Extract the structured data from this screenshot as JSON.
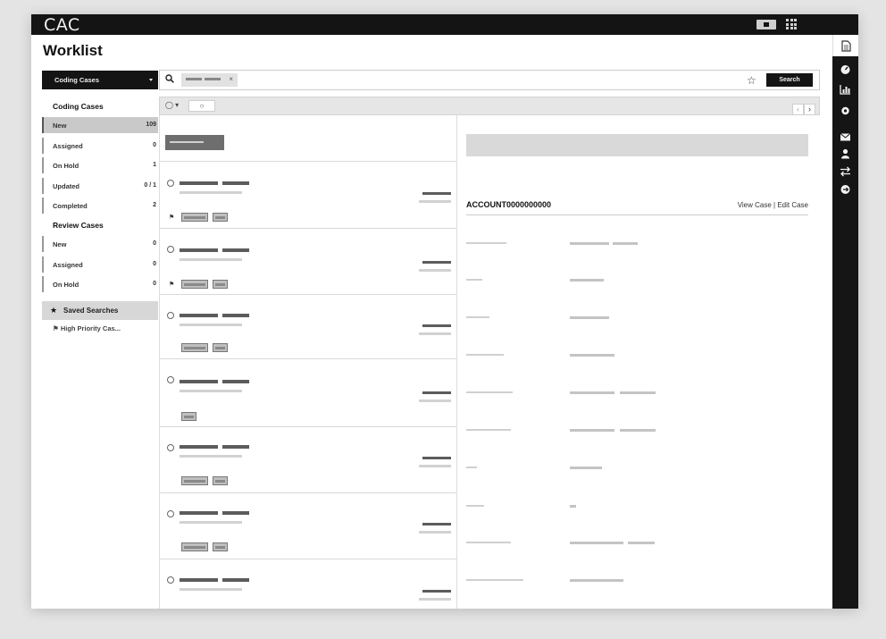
{
  "app": {
    "title": "CAC"
  },
  "page": {
    "title": "Worklist"
  },
  "sidebar": {
    "dropdown_label": "Coding Cases",
    "coding_heading": "Coding Cases",
    "coding_items": [
      {
        "label": "New",
        "count": "109"
      },
      {
        "label": "Assigned",
        "count": "0"
      },
      {
        "label": "On Hold",
        "count": "1"
      },
      {
        "label": "Updated",
        "count": "0 / 1"
      },
      {
        "label": "Completed",
        "count": "2"
      }
    ],
    "review_heading": "Review Cases",
    "review_items": [
      {
        "label": "New",
        "count": "0"
      },
      {
        "label": "Assigned",
        "count": "0"
      },
      {
        "label": "On Hold",
        "count": "0"
      }
    ],
    "saved_searches_label": "Saved Searches",
    "saved_search_item": "High Priority Cas..."
  },
  "search": {
    "button_label": "Search",
    "chip_remove": "×"
  },
  "toolbar": {
    "refresh_glyph": "○",
    "prev_glyph": "‹",
    "next_glyph": "›"
  },
  "detail": {
    "account": "ACCOUNT0000000000",
    "view_case": "View Case",
    "separator": " | ",
    "edit_case": "Edit Case"
  },
  "colors": {
    "topbar": "#141414",
    "rail": "#151515",
    "active_item": "#c9c9c9"
  }
}
